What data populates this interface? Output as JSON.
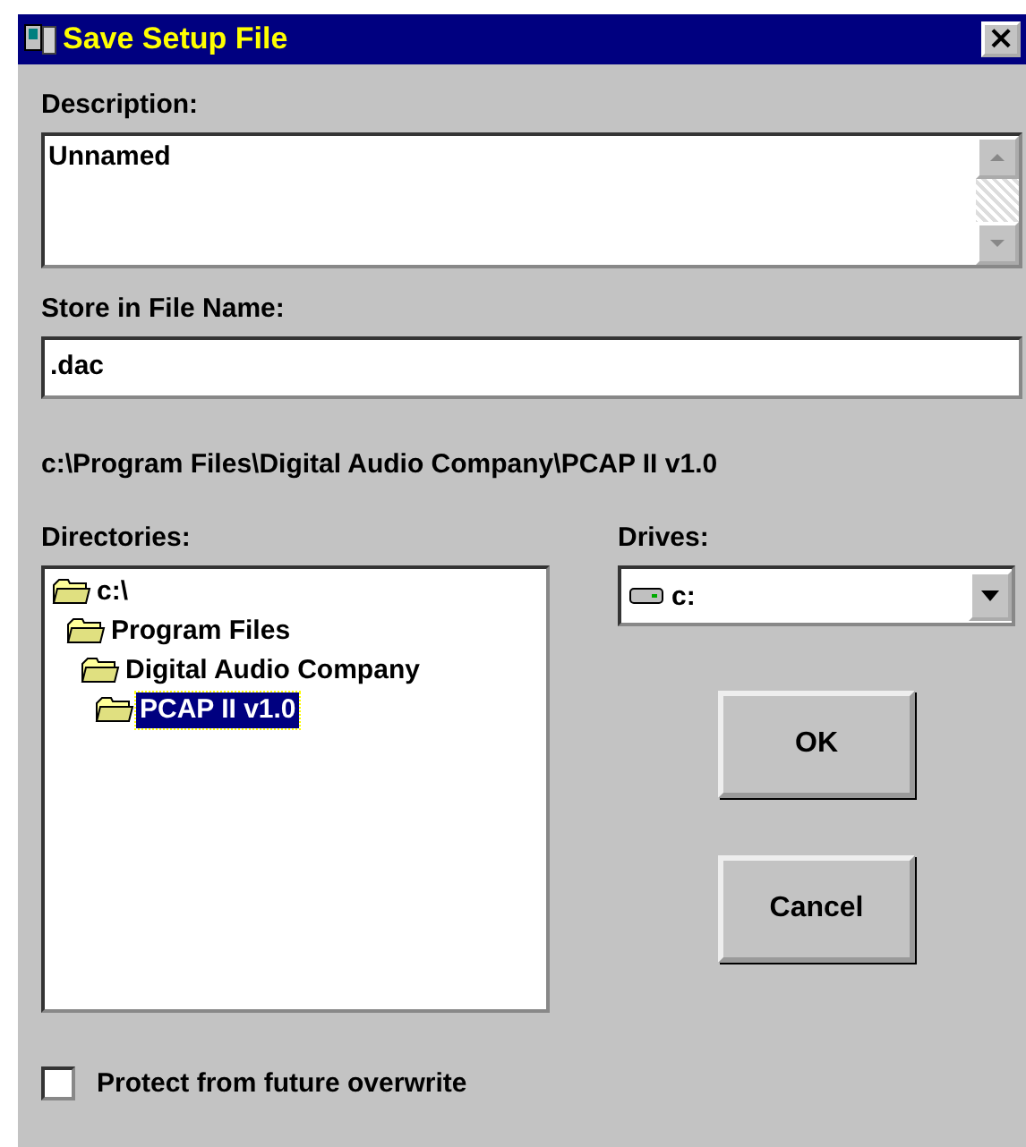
{
  "window": {
    "title": "Save Setup File",
    "close": "×"
  },
  "description": {
    "label": "Description:",
    "value": "Unnamed"
  },
  "file_name": {
    "label": "Store in File Name:",
    "value": ".dac"
  },
  "current_path": "c:\\Program Files\\Digital Audio Company\\PCAP II v1.0",
  "directories": {
    "label": "Directories:",
    "items": [
      {
        "name": "c:\\",
        "selected": false,
        "children": [
          {
            "name": "Program Files",
            "selected": false,
            "children": [
              {
                "name": "Digital Audio Company",
                "selected": false,
                "children": [
                  {
                    "name": "PCAP II v1.0",
                    "selected": true
                  }
                ]
              }
            ]
          }
        ]
      }
    ]
  },
  "drives": {
    "label": "Drives:",
    "value": "c:"
  },
  "buttons": [
    "OK",
    "Cancel"
  ],
  "protect": {
    "label": "Protect from future overwrite",
    "checked": false
  }
}
